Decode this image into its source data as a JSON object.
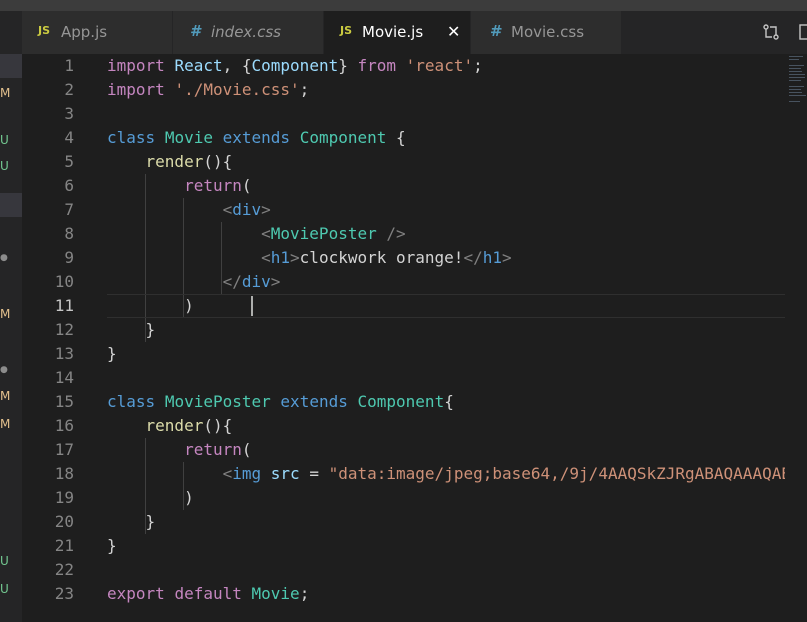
{
  "tabs": [
    {
      "icon": "JS",
      "label": "App.js",
      "active": false
    },
    {
      "icon": "#",
      "label": "index.css",
      "active": false
    },
    {
      "icon": "JS",
      "label": "Movie.js",
      "active": true
    },
    {
      "icon": "#",
      "label": "Movie.css",
      "active": false
    }
  ],
  "close_glyph": "✕",
  "sidebar_marks": [
    {
      "text": "M",
      "color": "#e2c08d"
    },
    {
      "text": "U",
      "color": "#73c991"
    },
    {
      "text": "U",
      "color": "#73c991"
    },
    {
      "text": "●",
      "color": "#8c8c8c"
    },
    {
      "text": "M",
      "color": "#e2c08d"
    },
    {
      "text": "●",
      "color": "#8c8c8c"
    },
    {
      "text": "M",
      "color": "#e2c08d"
    },
    {
      "text": "M",
      "color": "#e2c08d"
    },
    {
      "text": "U",
      "color": "#73c991"
    },
    {
      "text": "U",
      "color": "#73c991"
    }
  ],
  "editor": {
    "current_line": 11,
    "lines": [
      {
        "num": "1",
        "tokens": [
          [
            "k",
            "import"
          ],
          [
            "pl",
            " "
          ],
          [
            "var",
            "React"
          ],
          [
            "pl",
            ", {"
          ],
          [
            "var",
            "Component"
          ],
          [
            "pl",
            "} "
          ],
          [
            "k",
            "from"
          ],
          [
            "pl",
            " "
          ],
          [
            "str",
            "'react'"
          ],
          [
            "pl",
            ";"
          ]
        ]
      },
      {
        "num": "2",
        "tokens": [
          [
            "k",
            "import"
          ],
          [
            "pl",
            " "
          ],
          [
            "str",
            "'./Movie.css'"
          ],
          [
            "pl",
            ";"
          ]
        ]
      },
      {
        "num": "3",
        "tokens": []
      },
      {
        "num": "4",
        "tokens": [
          [
            "kw",
            "class"
          ],
          [
            "pl",
            " "
          ],
          [
            "cls",
            "Movie"
          ],
          [
            "pl",
            " "
          ],
          [
            "kw",
            "extends"
          ],
          [
            "pl",
            " "
          ],
          [
            "cls",
            "Component"
          ],
          [
            "pl",
            " {"
          ]
        ]
      },
      {
        "num": "5",
        "tokens": [
          [
            "pl",
            "    "
          ],
          [
            "fn",
            "render"
          ],
          [
            "pl",
            "(){"
          ]
        ]
      },
      {
        "num": "6",
        "tokens": [
          [
            "pl",
            "        "
          ],
          [
            "k",
            "return"
          ],
          [
            "pl",
            "("
          ]
        ]
      },
      {
        "num": "7",
        "tokens": [
          [
            "pl",
            "            "
          ],
          [
            "br",
            "<"
          ],
          [
            "tag",
            "div"
          ],
          [
            "br",
            ">"
          ]
        ]
      },
      {
        "num": "8",
        "tokens": [
          [
            "pl",
            "                "
          ],
          [
            "br",
            "<"
          ],
          [
            "cls",
            "MoviePoster"
          ],
          [
            "pl",
            " "
          ],
          [
            "br",
            "/>"
          ]
        ]
      },
      {
        "num": "9",
        "tokens": [
          [
            "pl",
            "                "
          ],
          [
            "br",
            "<"
          ],
          [
            "tag",
            "h1"
          ],
          [
            "br",
            ">"
          ],
          [
            "txt",
            "clockwork orange!"
          ],
          [
            "br",
            "</"
          ],
          [
            "tag",
            "h1"
          ],
          [
            "br",
            ">"
          ]
        ]
      },
      {
        "num": "10",
        "tokens": [
          [
            "pl",
            "            "
          ],
          [
            "br",
            "</"
          ],
          [
            "tag",
            "div"
          ],
          [
            "br",
            ">"
          ]
        ]
      },
      {
        "num": "11",
        "tokens": [
          [
            "pl",
            "        )"
          ]
        ]
      },
      {
        "num": "12",
        "tokens": [
          [
            "pl",
            "    }"
          ]
        ]
      },
      {
        "num": "13",
        "tokens": [
          [
            "pl",
            "}"
          ]
        ]
      },
      {
        "num": "14",
        "tokens": []
      },
      {
        "num": "15",
        "tokens": [
          [
            "kw",
            "class"
          ],
          [
            "pl",
            " "
          ],
          [
            "cls",
            "MoviePoster"
          ],
          [
            "pl",
            " "
          ],
          [
            "kw",
            "extends"
          ],
          [
            "pl",
            " "
          ],
          [
            "cls",
            "Component"
          ],
          [
            "pl",
            "{"
          ]
        ]
      },
      {
        "num": "16",
        "tokens": [
          [
            "pl",
            "    "
          ],
          [
            "fn",
            "render"
          ],
          [
            "pl",
            "(){"
          ]
        ]
      },
      {
        "num": "17",
        "tokens": [
          [
            "pl",
            "        "
          ],
          [
            "k",
            "return"
          ],
          [
            "pl",
            "("
          ]
        ]
      },
      {
        "num": "18",
        "tokens": [
          [
            "pl",
            "            "
          ],
          [
            "br",
            "<"
          ],
          [
            "tag",
            "img"
          ],
          [
            "pl",
            " "
          ],
          [
            "att",
            "src"
          ],
          [
            "pl",
            " = "
          ],
          [
            "str",
            "\"data:image/jpeg;base64,/9j/4AAQSkZJRgABAQAAAQAB"
          ]
        ]
      },
      {
        "num": "19",
        "tokens": [
          [
            "pl",
            "        )"
          ]
        ]
      },
      {
        "num": "20",
        "tokens": [
          [
            "pl",
            "    }"
          ]
        ]
      },
      {
        "num": "21",
        "tokens": [
          [
            "pl",
            "}"
          ]
        ]
      },
      {
        "num": "22",
        "tokens": []
      },
      {
        "num": "23",
        "tokens": [
          [
            "k",
            "export"
          ],
          [
            "pl",
            " "
          ],
          [
            "k",
            "default"
          ],
          [
            "pl",
            " "
          ],
          [
            "cls",
            "Movie"
          ],
          [
            "pl",
            ";"
          ]
        ]
      }
    ]
  }
}
